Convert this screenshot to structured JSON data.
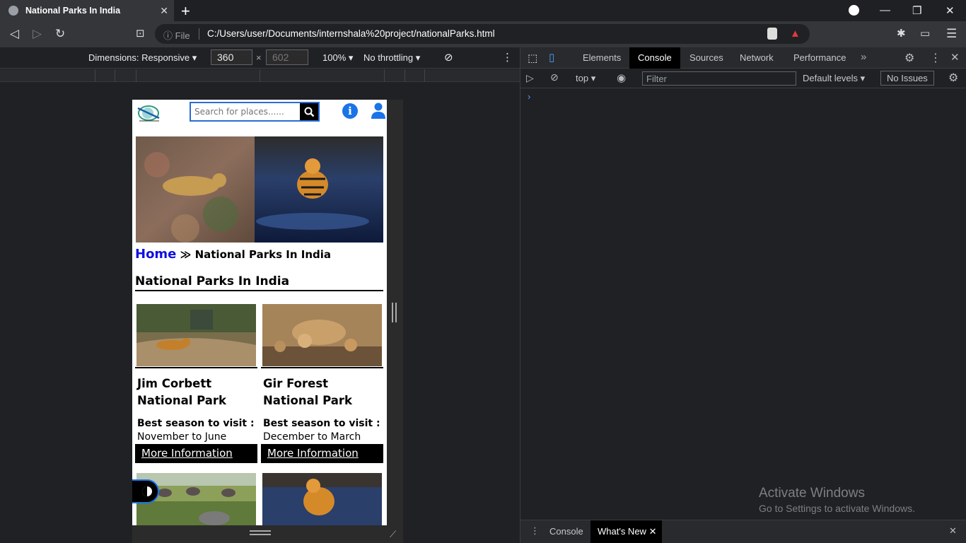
{
  "browser": {
    "tab_title": "National Parks In India",
    "address_prefix": "File",
    "url": "C:/Users/user/Documents/internshala%20project/nationalParks.html"
  },
  "device_toolbar": {
    "dimensions_label": "Dimensions: Responsive",
    "width": "360",
    "height": "602",
    "zoom": "100%",
    "throttling": "No throttling"
  },
  "page": {
    "search_placeholder": "Search for places......",
    "breadcrumb_home": "Home",
    "breadcrumb_sep": "≫",
    "breadcrumb_current": "National Parks In India",
    "title": "National Parks In India",
    "cards": [
      {
        "name": "Jim Corbett National Park",
        "season_label": "Best season to visit :",
        "season": "November to June",
        "link": "More Information"
      },
      {
        "name": "Gir Forest National Park",
        "season_label": "Best season to visit :",
        "season": "December to March",
        "link": "More Information"
      }
    ]
  },
  "devtools": {
    "tabs": [
      "Elements",
      "Console",
      "Sources",
      "Network",
      "Performance"
    ],
    "active_tab": "Console",
    "context": "top",
    "filter_placeholder": "Filter",
    "levels": "Default levels",
    "issues": "No Issues",
    "drawer_tabs": [
      "Console",
      "What's New"
    ]
  },
  "watermark": {
    "line1": "Activate Windows",
    "line2": "Go to Settings to activate Windows."
  }
}
